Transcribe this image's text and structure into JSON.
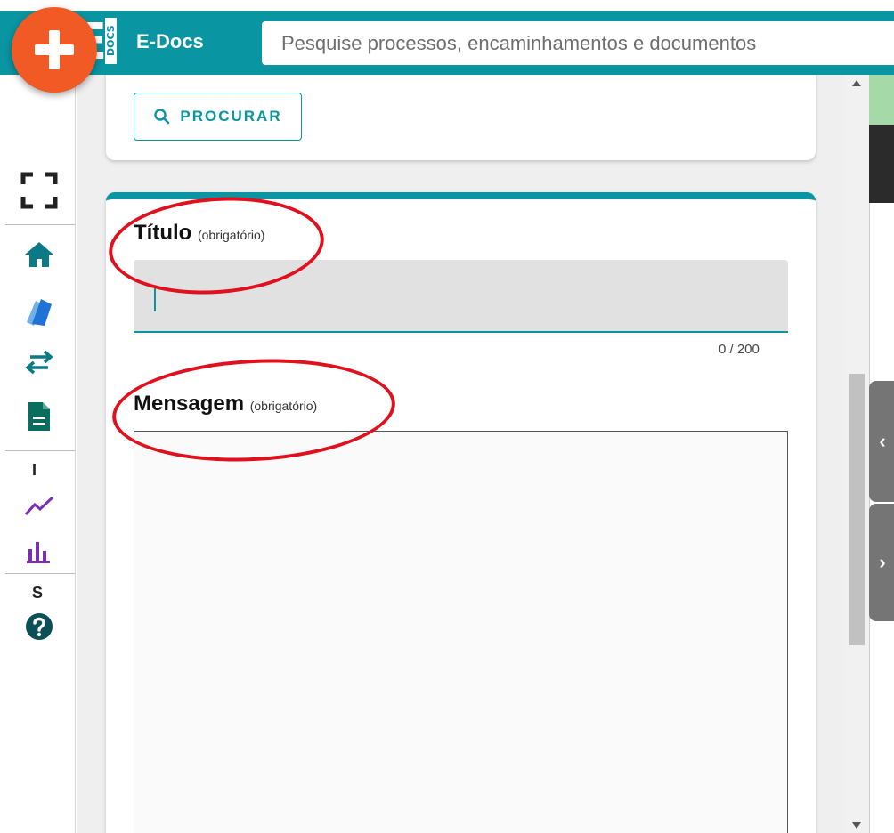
{
  "app": {
    "brand": "E-Docs",
    "logo_letter": "E",
    "logo_docs": "DOCS"
  },
  "search": {
    "placeholder": "Pesquise processos, encaminhamentos e documentos"
  },
  "sidebar": {
    "section_i": "I",
    "section_s": "S"
  },
  "toolbar": {
    "procurar_label": "PROCURAR"
  },
  "form": {
    "titulo_label": "Título",
    "titulo_required": "(obrigatório)",
    "titulo_value": "",
    "titulo_counter": "0 / 200",
    "mensagem_label": "Mensagem",
    "mensagem_required": "(obrigatório)",
    "mensagem_value": ""
  },
  "colors": {
    "primary": "#0a95a2",
    "fab": "#f15a24",
    "annotation": "#e0101d",
    "chart_icons": "#7b2fb0"
  },
  "right_panel": {
    "collapse_glyph": "‹",
    "expand_glyph": "›"
  }
}
